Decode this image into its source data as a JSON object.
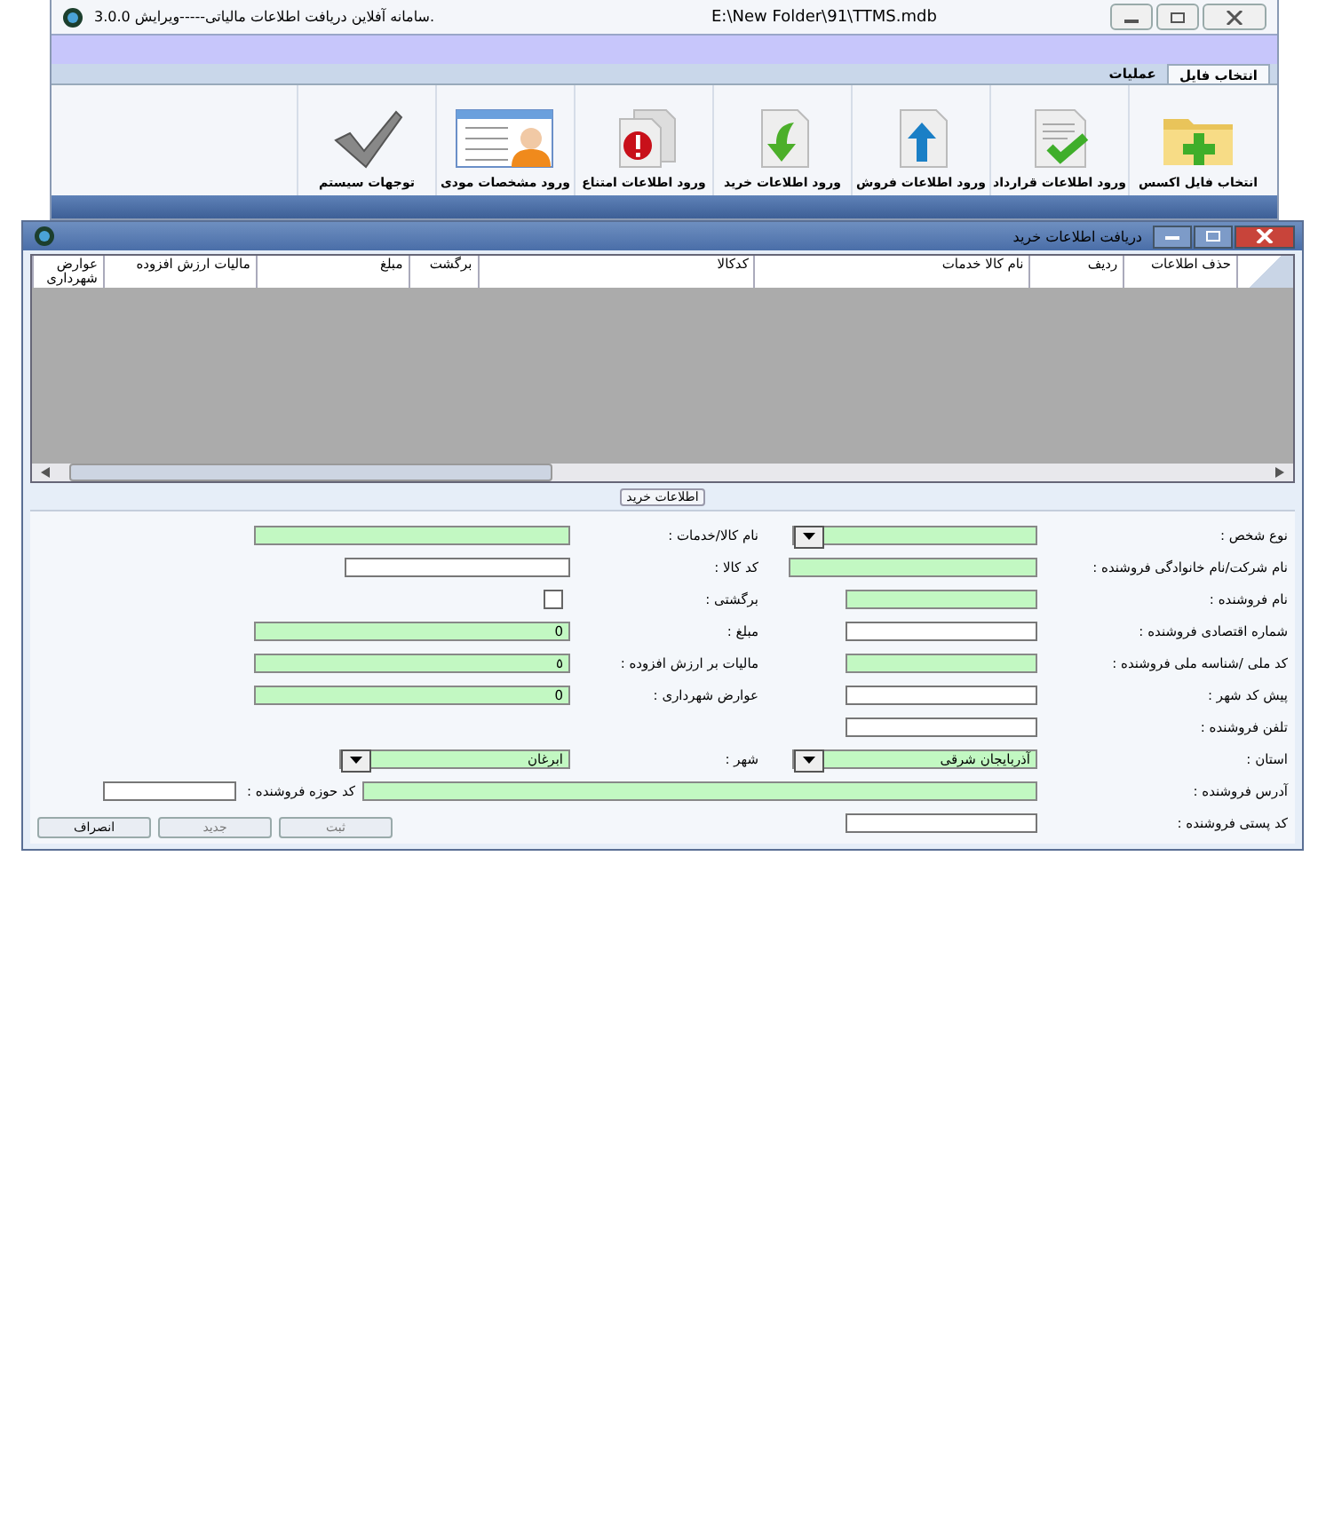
{
  "main_window": {
    "title": ".سامانه آفلاین دریافت اطلاعات مالیاتی-----ویرایش 3.0.0",
    "path": "E:\\New Folder\\91\\TTMS.mdb"
  },
  "tabs": [
    {
      "label": "انتخاب فایل",
      "selected": true
    },
    {
      "label": "عملیات",
      "selected": false
    }
  ],
  "ribbon_buttons": [
    "انتخاب فایل اکسس",
    "ورود اطلاعات قرارداد",
    "ورود اطلاعات فروش",
    "ورود اطلاعات خرید",
    "ورود اطلاعات امتناع",
    "ورود مشخصات مودی",
    "توجهات سیستم"
  ],
  "dialog": {
    "title": "دریافت اطلاعات خرید",
    "table": {
      "columns": [
        "حذف اطلاعات",
        "ردیف",
        "نام کالا خدمات",
        "کدکالا",
        "برگشت",
        "مبلغ",
        "مالیات ارزش افزوده",
        "عوارض شهرداری"
      ]
    },
    "group_label": "اطلاعات خرید",
    "rows": [
      {
        "right": {
          "label": "نوع شخص :",
          "kind": "combo",
          "required": true
        },
        "left": {
          "label": "نام کالا/خدمات :",
          "kind": "text",
          "required": true
        }
      },
      {
        "right": {
          "label": "نام شرکت/نام خانوادگی فروشنده :",
          "kind": "text",
          "required": true
        },
        "left": {
          "label": "کد کالا :",
          "kind": "text",
          "required": false
        }
      },
      {
        "right": {
          "label": "نام فروشنده :",
          "kind": "text",
          "required": true
        },
        "left": {
          "label": "برگشتی :",
          "kind": "checkbox",
          "checked": false
        }
      },
      {
        "right": {
          "label": "شماره اقتصادی فروشنده :",
          "kind": "text",
          "required": false
        },
        "left": {
          "label": "مبلغ :",
          "kind": "text",
          "required": true,
          "value": "0"
        }
      },
      {
        "right": {
          "label": "کد ملی /شناسه ملی فروشنده :",
          "kind": "text",
          "required": true
        },
        "left": {
          "label": "مالیات بر ارزش افزوده :",
          "kind": "text",
          "required": true,
          "value": "٥"
        }
      },
      {
        "right": {
          "label": "پیش کد شهر :",
          "kind": "text",
          "required": false
        },
        "left": {
          "label": "عوارض شهرداری :",
          "kind": "text",
          "required": true,
          "value": "0"
        }
      },
      {
        "right": {
          "label": "تلفن فروشنده :",
          "kind": "text",
          "required": false
        }
      },
      {
        "right": {
          "label": "استان :",
          "kind": "combo",
          "required": true,
          "value": "آذربایجان شرقی"
        },
        "left": {
          "label": "شهر :",
          "kind": "combo",
          "required": true,
          "value": "ابرغان"
        }
      },
      {
        "right": {
          "label": "آدرس فروشنده :",
          "kind": "wide",
          "required": true
        },
        "left": {
          "label": "کد حوزه فروشنده :",
          "kind": "text",
          "required": false
        }
      },
      {
        "right": {
          "label": "کد پستی فروشنده :",
          "kind": "text",
          "required": false
        }
      }
    ],
    "buttons": [
      {
        "label": "ثبت",
        "disabled": true
      },
      {
        "label": "جدید",
        "disabled": true
      },
      {
        "label": "انصراف",
        "disabled": false
      }
    ]
  }
}
